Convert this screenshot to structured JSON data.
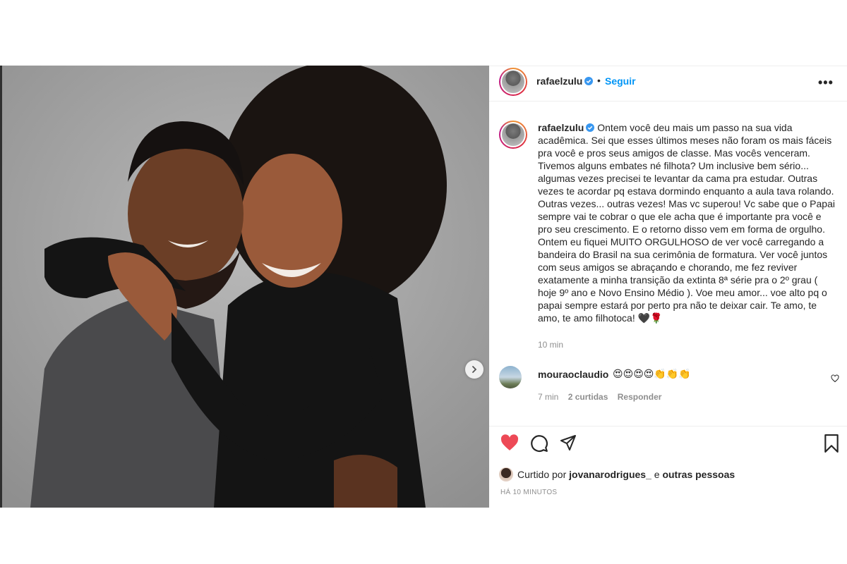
{
  "post": {
    "username": "rafaelzulu",
    "separator": "•",
    "follow_label": "Seguir",
    "more_label": "•••"
  },
  "caption": {
    "username": "rafaelzulu",
    "lines": [
      "Ontem você deu mais um passo na sua vida",
      "acadêmica. Sei que esses últimos meses não foram os mais fáceis",
      "pra você e pros seus amigos de classe. Mas vocês venceram.",
      "Tivemos alguns embates né filhota? Um inclusive bem sério...",
      "algumas vezes precisei te levantar da cama pra estudar. Outras",
      "vezes te acordar pq estava dormindo enquanto a aula tava rolando.",
      "Outras vezes... outras vezes! Mas vc superou! Vc sabe que o Papai",
      "sempre vai te cobrar o que ele acha que é importante pra você e",
      "pro seu crescimento. E o retorno disso vem em forma de orgulho.",
      "Ontem eu fiquei MUITO ORGULHOSO de ver você carregando a",
      "bandeira do Brasil na sua cerimônia de formatura. Ver você juntos",
      "com seus amigos se abraçando e chorando, me fez reviver",
      "exatamente a minha transição da extinta 8ª série pra o 2º grau (",
      "hoje 9º ano e Novo Ensino Médio ). Voe meu amor... voe alto pq o",
      "papai sempre estará por perto pra não te deixar cair. Te amo, te",
      "amo, te amo filhotoca! 🖤🌹"
    ],
    "time": "10 min"
  },
  "comment": {
    "username": "mouraoclaudio",
    "text": "😍😍😍😍👏👏👏",
    "time": "7 min",
    "likes": "2 curtidas",
    "reply": "Responder"
  },
  "likes": {
    "prefix": "Curtido por",
    "user": "jovanarodrigues_",
    "joiner": "e",
    "others": "outras pessoas"
  },
  "timestamp": "HÁ 10 MINUTOS",
  "icons": {
    "verified": "verified-badge-icon",
    "like": "heart-filled-icon",
    "comment": "comment-bubble-icon",
    "share": "paper-plane-icon",
    "save": "bookmark-icon",
    "next": "chevron-right-icon"
  },
  "colors": {
    "link_blue": "#0095f6",
    "like_red": "#ed4956",
    "muted": "#8e8e8e",
    "text": "#262626"
  }
}
